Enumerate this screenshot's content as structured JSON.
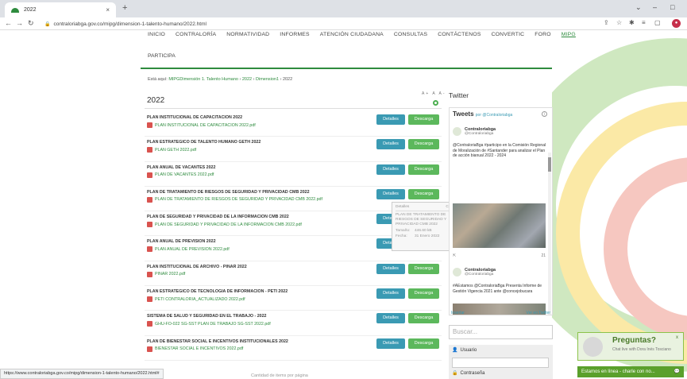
{
  "browser": {
    "tab_title": "2022",
    "tab_close": "×",
    "new_tab": "+",
    "url": "contraloriabga.gov.co/mipg/dimension-1-talento-humano/2022.html",
    "status_url": "https://www.contraloriabga.gov.co/mipg/dimension-1-talento-humano/2022.html#"
  },
  "nav": {
    "items": [
      "INICIO",
      "CONTRALORÍA",
      "NORMATIVIDAD",
      "INFORMES",
      "ATENCIÓN CIUDADANA",
      "CONSULTAS",
      "CONTÁCTENOS",
      "CONVERTIC",
      "FORO",
      "MIPG"
    ],
    "second_row": "PARTICIPA"
  },
  "breadcrumb": {
    "prefix": "Está aquí:",
    "items": [
      "MIPG",
      "Dimensión 1. Talento Humano",
      "2022",
      "Dimension1",
      "2022"
    ]
  },
  "font_controls": "A+ A A-",
  "year_heading": "2022",
  "buttons": {
    "details": "Detalles",
    "download": "Descarga"
  },
  "documents": [
    {
      "title": "PLAN INSTITUCIONAL DE CAPACITACION 2022",
      "file": "PLAN INSTITUCIONAL DE CAPACITACION 2022.pdf"
    },
    {
      "title": "PLAN ESTRATEGICO DE TALENTO HUMANO GETH 2022",
      "file": "PLAN GETH 2022.pdf"
    },
    {
      "title": "PLAN ANUAL DE VACANTES 2022",
      "file": "PLAN DE VACANTES 2022.pdf"
    },
    {
      "title": "PLAN DE TRATAMIENTO DE RIESGOS DE SEGURIDAD Y PRIVACIDAD CMB 2022",
      "file": "PLAN DE TRATAMIENTO DE RIESGOS DE SEGURIDAD Y PRIVACIDAD CMB 2022.pdf"
    },
    {
      "title": "PLAN DE SEGURIDAD Y PRIVACIDAD DE LA INFORMACION CMB 2022",
      "file": "PLAN DE SEGURIDAD Y PRIVACIDAD DE LA INFORMACION CMB 2022.pdf"
    },
    {
      "title": "PLAN ANUAL DE PREVISION 2022",
      "file": "PLAN ANUAL DE PREVISION 2022.pdf"
    },
    {
      "title": "PLAN INSTITUCIONAL DE ARCHIVO - PINAR 2022",
      "file": "PINAR 2022.pdf"
    },
    {
      "title": "PLAN ESTRATEGICO DE TECNOLOGIA DE INFORMACION - PETI 2022",
      "file": "PETI CONTRALORIA_ACTUALIZADO 2022.pdf"
    },
    {
      "title": "SISTEMA DE SALUD Y SEGURIDAD EN EL TRABAJO - 2022",
      "file": "GHU-FO-022 SG-SST PLAN DE TRABAJO SG-SST 2022.pdf"
    },
    {
      "title": "PLAN DE BIENESTAR SOCIAL E INCENTIVOS INSTITUCIONALES 2022",
      "file": "BIENESTAR SOCIAL E INCENTIVOS 2022.pdf"
    }
  ],
  "popover": {
    "header": "Detalles",
    "close": "Cerrar",
    "title": "PLAN DE TRATAMIENTO DE RIESGOS DE SEGURIDAD Y PRIVACIDAD CMB 2022",
    "size_label": "Tamaño:",
    "size_value": "446.60 kB",
    "date_label": "Fecha:",
    "date_value": "31 Enero 2022"
  },
  "twitter": {
    "section_title": "Twitter",
    "widget_title": "Tweets",
    "widget_by": "por @Contraloriabga",
    "user_name": "Contraloriabga",
    "user_handle": "@Contraloriabga",
    "tweet1": "@ContraloriaBga #participo en la Comisión Regional de Moralización de #Santander para analizar el Plan de acción bianual 2022 - 2024",
    "retweet_count": "21",
    "tweet2": "#AEstamos @ContraloriaBga Presenta Informe de Gestión Vigencia 2021 ante @concejobucara",
    "embed": "Insertar",
    "view_on": "Ver en Twitter"
  },
  "search_placeholder": "Buscar...",
  "login": {
    "user_label": "Usuario",
    "password_label": "Contraseña"
  },
  "chat": {
    "title": "Preguntas?",
    "subtitle": "Chat live with Dora Inés Tosciano",
    "close": "x",
    "bar": "Estamos en línea - charle con no..."
  },
  "bottom_text": "Cantidad de items por página",
  "colors": {
    "brand_green": "#2e8b3e",
    "details_button": "#3a9ab3",
    "download_button": "#5cb85c"
  }
}
